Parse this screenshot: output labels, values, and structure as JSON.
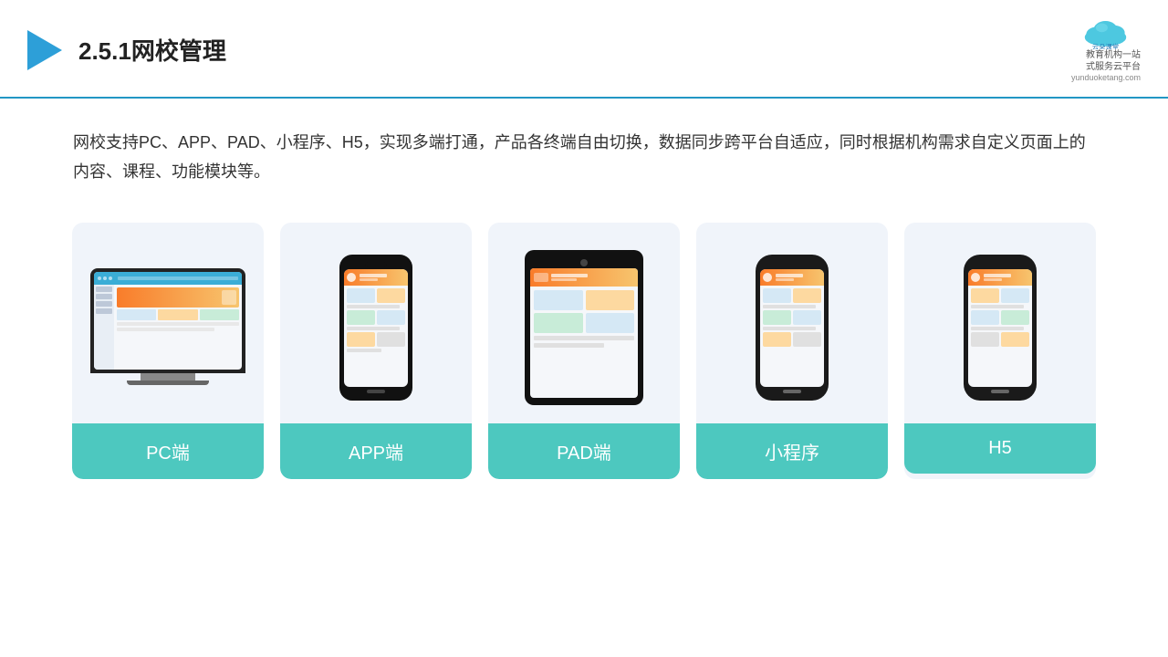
{
  "header": {
    "title": "2.5.1网校管理",
    "logo_name": "云朵课堂",
    "logo_url": "yunduoketang.com",
    "logo_tagline": "教育机构一站",
    "logo_tagline2": "式服务云平台"
  },
  "description": "网校支持PC、APP、PAD、小程序、H5，实现多端打通，产品各终端自由切换，数据同步跨平台自适应，同时根据机构需求自定义页面上的内容、课程、功能模块等。",
  "cards": [
    {
      "id": "pc",
      "label": "PC端"
    },
    {
      "id": "app",
      "label": "APP端"
    },
    {
      "id": "pad",
      "label": "PAD端"
    },
    {
      "id": "miniprogram",
      "label": "小程序"
    },
    {
      "id": "h5",
      "label": "H5"
    }
  ]
}
